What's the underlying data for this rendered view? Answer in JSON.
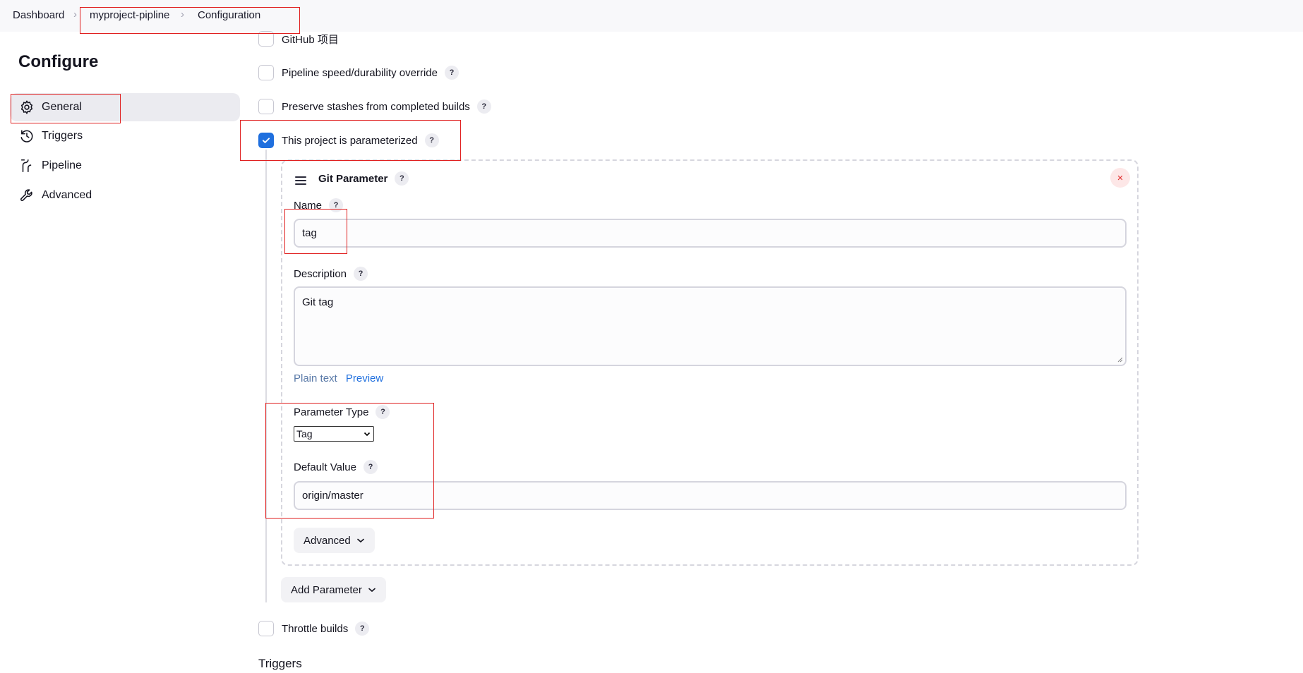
{
  "breadcrumb": {
    "items": [
      "Dashboard",
      "myproject-pipline",
      "Configuration"
    ]
  },
  "page": {
    "title": "Configure"
  },
  "sidebar": {
    "items": [
      {
        "label": "General",
        "icon": "gear-icon",
        "active": true
      },
      {
        "label": "Triggers",
        "icon": "clock-icon"
      },
      {
        "label": "Pipeline",
        "icon": "pipeline-icon"
      },
      {
        "label": "Advanced",
        "icon": "wrench-icon"
      }
    ]
  },
  "options": {
    "github_project": "GitHub 项目",
    "pipeline_speed": "Pipeline speed/durability override",
    "preserve_stashes": "Preserve stashes from completed builds",
    "parameterized": "This project is parameterized",
    "throttle": "Throttle builds"
  },
  "help_label": "?",
  "git_parameter": {
    "title": "Git Parameter",
    "close_label": "×",
    "name_label": "Name",
    "name_value": "tag",
    "description_label": "Description",
    "description_value": "Git tag",
    "plain_text_label": "Plain text",
    "preview_label": "Preview",
    "parameter_type_label": "Parameter Type",
    "parameter_type_value": "Tag",
    "default_value_label": "Default Value",
    "default_value": "origin/master",
    "advanced_label": "Advanced"
  },
  "add_parameter_label": "Add Parameter",
  "next_section_title": "Triggers",
  "colors": {
    "accent": "#1f6fde",
    "highlight_box": "#e02020"
  }
}
